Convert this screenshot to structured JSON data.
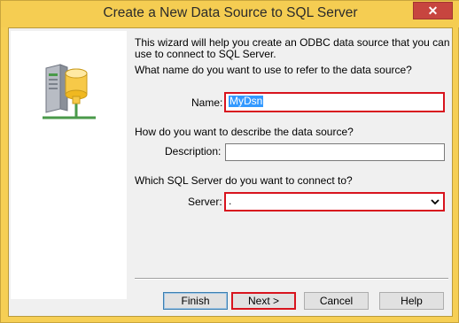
{
  "window": {
    "title": "Create a New Data Source to SQL Server",
    "close_label": "✕"
  },
  "intro": {
    "text": "This wizard will help you create an ODBC data source that you can use to connect to SQL Server."
  },
  "name_section": {
    "question": "What name do you want to use to refer to the data source?",
    "label": "Name:",
    "value": "MyDsn"
  },
  "description_section": {
    "question": "How do you want to describe the data source?",
    "label": "Description:",
    "value": ""
  },
  "server_section": {
    "question": "Which SQL Server do you want to connect to?",
    "label": "Server:",
    "value": "."
  },
  "buttons": {
    "finish": "Finish",
    "next": "Next >",
    "cancel": "Cancel",
    "help": "Help"
  },
  "icons": {
    "server": "database-server-icon",
    "dropdown": "chevron-down-icon"
  },
  "colors": {
    "highlight_border": "#d8141e",
    "selection": "#3399ff",
    "titlebar": "#f5cd52"
  }
}
